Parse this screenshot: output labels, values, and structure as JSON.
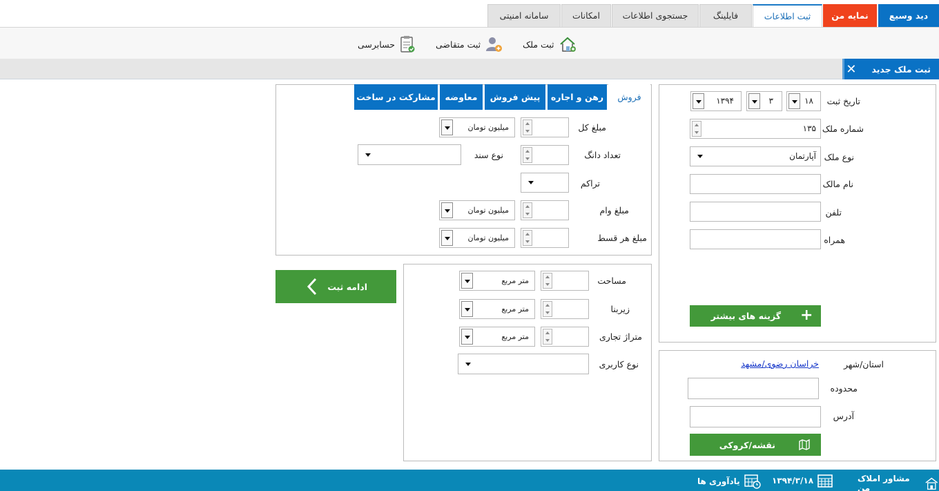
{
  "top_tabs": {
    "wide_view": "دید وسیع",
    "my_view": "نمایه من",
    "register_info": "ثبت اطلاعات",
    "filing": "فایلینگ",
    "search_info": "جستجوی اطلاعات",
    "facilities": "امکانات",
    "security_system": "سامانه امنیتی"
  },
  "toolbar": {
    "register_property": "ثبت ملک",
    "register_applicant": "ثبت متقاضی",
    "audit": "حسابرسی"
  },
  "section_tab": {
    "label": "ثبت ملک جدید",
    "close": "✕"
  },
  "left_panel": {
    "reg_date_label": "تاریخ ثبت",
    "reg_date_day": "۱۸",
    "reg_date_month": "۳",
    "reg_date_year": "۱۳۹۴",
    "property_number_label": "شماره ملک",
    "property_number": "۱۳۵",
    "property_type_label": "نوع ملک",
    "property_type": "آپارتمان",
    "owner_name_label": "نام مالک",
    "phone_label": "تلفن",
    "mobile_label": "همراه",
    "more_options": "گزینه های بیشتر"
  },
  "location_panel": {
    "province_city_label": "استان/شهر",
    "province_city": "خراسان رضوی/مشهد",
    "area_label": "محدوده",
    "address_label": "آدرس",
    "map_button": "نقشه/کروکی"
  },
  "transaction_tabs": [
    "فروش",
    "رهن و اجاره",
    "پیش فروش",
    "معاوضه",
    "مشارکت در ساخت"
  ],
  "sale_panel": {
    "total_price_label": "مبلغ کل",
    "total_price_unit": "میلیون تومان",
    "dang_count_label": "تعداد دانگ",
    "deed_type_label": "نوع سند",
    "density_label": "تراکم",
    "loan_amount_label": "مبلغ وام",
    "loan_amount_unit": "میلیون تومان",
    "installment_label": "مبلغ هر قسط",
    "installment_unit": "میلیون تومان"
  },
  "area_panel": {
    "area_label": "مساحت",
    "area_unit": "متر مربع",
    "built_area_label": "زیربنا",
    "built_area_unit": "متر مربع",
    "commercial_frontage_label": "متراژ تجاری",
    "commercial_frontage_unit": "متر مربع",
    "usage_type_label": "نوع کاربری"
  },
  "continue_button": "ادامه ثبت",
  "footer": {
    "app_name": "مشاور املاک من",
    "date": "۱۳۹۴/۳/۱۸",
    "reminders": "یادآوری ها"
  }
}
